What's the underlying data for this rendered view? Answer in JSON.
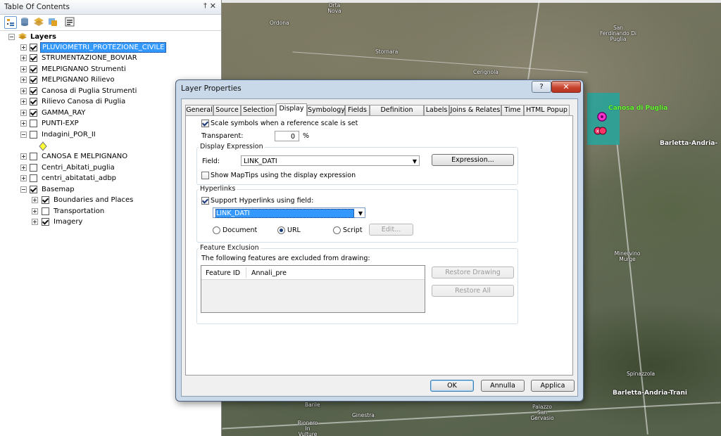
{
  "toc": {
    "title": "Table Of Contents",
    "pin": "†",
    "close": "✕",
    "root": "Layers",
    "layers": [
      {
        "label": "PLUVIOMETRI_PROTEZIONE_CIVILE",
        "checked": true,
        "selected": true
      },
      {
        "label": "STRUMENTAZIONE_BOVIAR",
        "checked": true
      },
      {
        "label": "MELPIGNANO Strumenti",
        "checked": true
      },
      {
        "label": "MELPIGNANO Rilievo",
        "checked": true
      },
      {
        "label": "Canosa di Puglia Strumenti",
        "checked": true
      },
      {
        "label": "Rilievo Canosa di Puglia",
        "checked": true
      },
      {
        "label": "GAMMA_RAY",
        "checked": true
      },
      {
        "label": "PUNTI-EXP",
        "checked": false
      },
      {
        "label": "Indagini_POR_II",
        "checked": false
      },
      {
        "label": "CANOSA E MELPIGNANO",
        "checked": false
      },
      {
        "label": "Centri_Abitati_puglia",
        "checked": false
      },
      {
        "label": "centri_abitatati_adbp",
        "checked": false
      },
      {
        "label": "Basemap",
        "checked": true
      },
      {
        "label": "Boundaries and Places",
        "checked": true
      },
      {
        "label": "Transportation",
        "checked": false
      },
      {
        "label": "Imagery",
        "checked": true
      }
    ]
  },
  "map": {
    "places": [
      "Orta Nova",
      "Ordona",
      "Stornara",
      "Cerignola",
      "San Ferdinando Di Puglia",
      "Canosa di Puglia",
      "Barletta-Andria-",
      "Minervino Murge",
      "Spinazzola",
      "Barletta-Andria-Trani",
      "Barile",
      "Ginestra",
      "Rionero In Vulture",
      "Palazzo San Gervasio"
    ],
    "canosa_color": "#66ff33"
  },
  "dialog": {
    "title": "Layer Properties",
    "help": "?",
    "close": "✕",
    "tabs": [
      "General",
      "Source",
      "Selection",
      "Display",
      "Symbology",
      "Fields",
      "Definition Query",
      "Labels",
      "Joins & Relates",
      "Time",
      "HTML Popup"
    ],
    "active_tab": "Display",
    "scale_symbols": "Scale symbols when a reference scale is set",
    "transparent_label": "Transparent:",
    "transparent_value": "0",
    "percent": "%",
    "display_expression": {
      "title": "Display Expression",
      "field_label": "Field:",
      "field_value": "LINK_DATI",
      "expression_button": "Expression...",
      "show_maptips": "Show MapTips using the display expression"
    },
    "hyperlinks": {
      "title": "Hyperlinks",
      "support": "Support Hyperlinks using field:",
      "field_value": "LINK_DATI",
      "document": "Document",
      "url": "URL",
      "script": "Script",
      "edit": "Edit..."
    },
    "feature_exclusion": {
      "title": "Feature Exclusion",
      "description": "The following features are excluded from drawing:",
      "columns": [
        "Feature ID",
        "Annali_pre"
      ],
      "restore_drawing": "Restore Drawing",
      "restore_all": "Restore All"
    },
    "buttons": {
      "ok": "OK",
      "cancel": "Annulla",
      "apply": "Applica"
    }
  }
}
